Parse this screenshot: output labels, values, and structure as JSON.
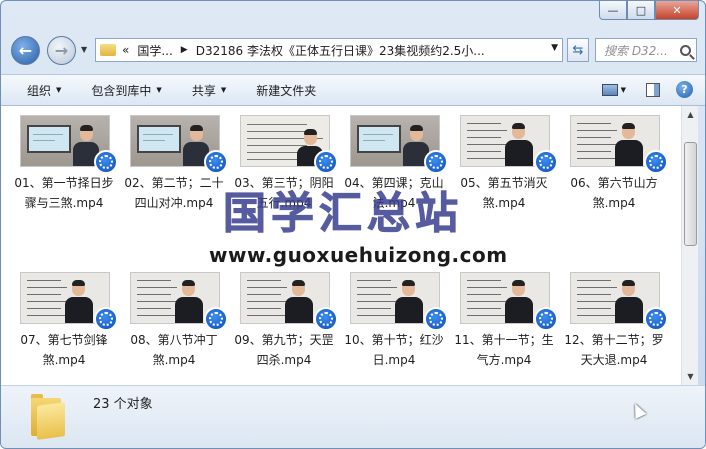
{
  "caption": {
    "minimize": "—",
    "maximize": "□",
    "close": "✕"
  },
  "nav": {
    "address_crumbs": [
      "«",
      "国学...",
      "D32186 李法权《正体五行日课》23集视频约2.5小..."
    ],
    "search_placeholder": "搜索 D32..."
  },
  "toolbar": {
    "organize": "组织",
    "include_library": "包含到库中",
    "share": "共享",
    "new_folder": "新建文件夹"
  },
  "files": [
    {
      "name": "01、第一节择日步骤与三煞.mp4",
      "thumb": "board"
    },
    {
      "name": "02、第二节；二十四山对冲.mp4",
      "thumb": "board"
    },
    {
      "name": "03、第三节；阴阳五行.mp4",
      "thumb": "paper"
    },
    {
      "name": "04、第四课；克山法.mp4",
      "thumb": "board"
    },
    {
      "name": "05、第五节消灭煞.mp4",
      "thumb": "paper-man"
    },
    {
      "name": "06、第六节山方煞.mp4",
      "thumb": "paper-man"
    },
    {
      "name": "07、第七节剑锋煞.mp4",
      "thumb": "paper-man"
    },
    {
      "name": "08、第八节冲丁煞.mp4",
      "thumb": "paper-man"
    },
    {
      "name": "09、第九节；天罡四杀.mp4",
      "thumb": "paper-man"
    },
    {
      "name": "10、第十节；红沙日.mp4",
      "thumb": "paper-man"
    },
    {
      "name": "11、第十一节；生气方.mp4",
      "thumb": "paper-man"
    },
    {
      "name": "12、第十二节；罗天大退.mp4",
      "thumb": "paper-man"
    }
  ],
  "status": {
    "count": "23 个对象"
  },
  "watermark": {
    "title": "国学汇总站",
    "url": "www.guoxuehuizong.com"
  },
  "colors": {
    "accent": "#2c6bb1",
    "watermark": "#3a3f8f"
  }
}
